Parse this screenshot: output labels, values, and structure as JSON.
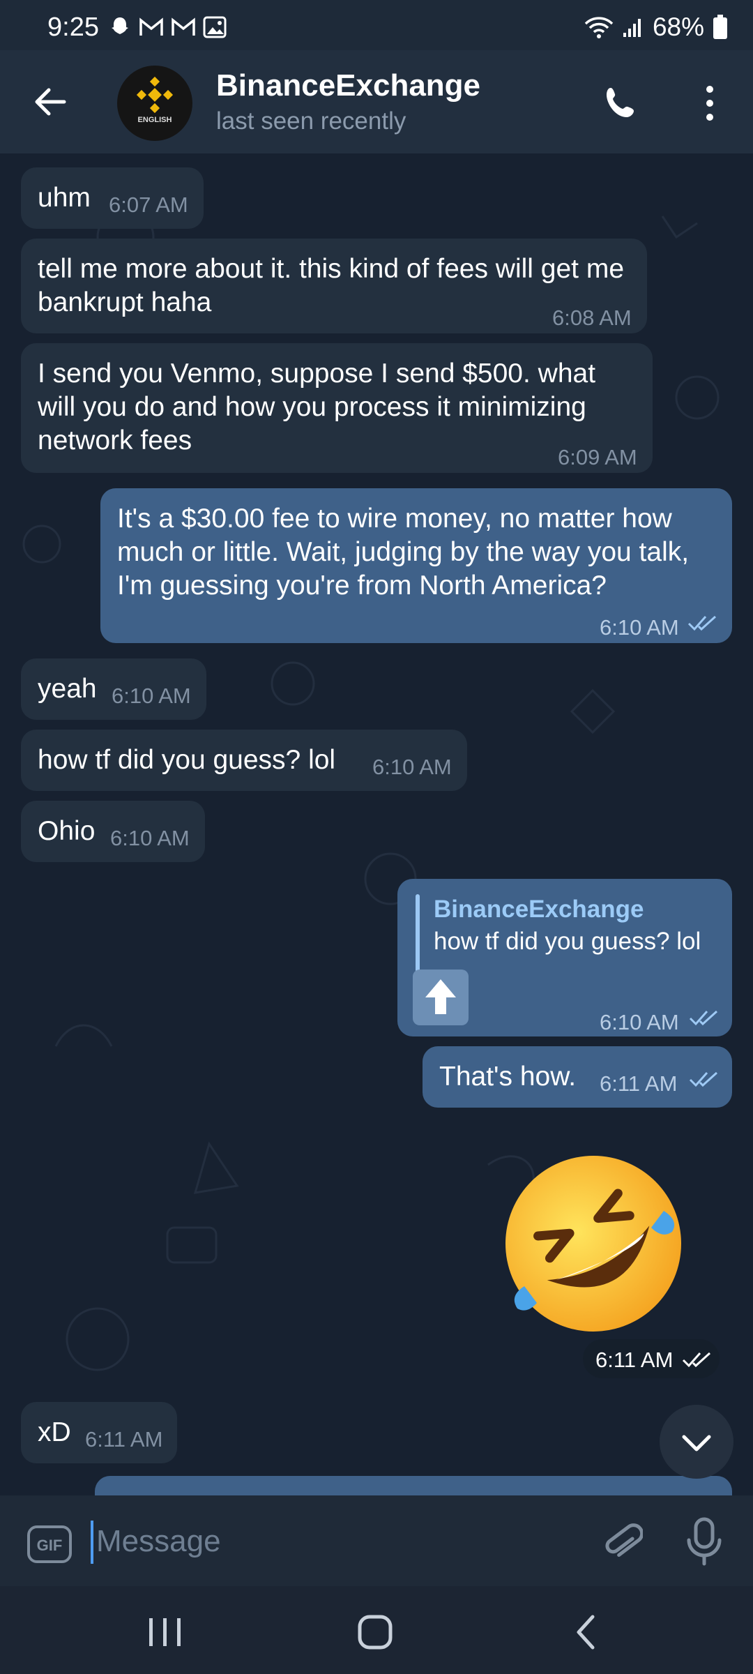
{
  "status": {
    "time": "9:25",
    "battery": "68%"
  },
  "chat": {
    "title": "BinanceExchange",
    "subtitle": "last seen recently",
    "avatar_label": "ENGLISH"
  },
  "messages": [
    {
      "text": "uhm",
      "time": "6:07 AM"
    },
    {
      "text": "tell me more about it. this kind of fees will get me bankrupt haha",
      "time": "6:08 AM"
    },
    {
      "text": "I send you Venmo, suppose I send $500. what will you do and how you process it minimizing network fees",
      "time": "6:09 AM"
    },
    {
      "text": "It's a $30.00 fee to wire money, no matter how much or little. Wait, judging by the way you talk, I'm guessing you're from North America?",
      "time": "6:10 AM"
    },
    {
      "text": "yeah",
      "time": "6:10 AM"
    },
    {
      "text": "how tf did you guess? lol",
      "time": "6:10 AM"
    },
    {
      "text": "Ohio",
      "time": "6:10 AM"
    },
    {
      "reply_name": "BinanceExchange",
      "reply_text": "how tf did you guess? lol",
      "time": "6:10 AM"
    },
    {
      "text": "That's how.",
      "time": "6:11 AM"
    },
    {
      "sticker": "rofl-emoji",
      "time": "6:11 AM"
    },
    {
      "text": "xD",
      "time": "6:11 AM"
    }
  ],
  "input": {
    "placeholder": "Message"
  },
  "icons": [
    "back-arrow-icon",
    "phone-icon",
    "more-vert-icon",
    "gif-icon",
    "attach-icon",
    "mic-icon",
    "chevron-down-icon",
    "double-check-icon"
  ],
  "colors": {
    "incoming": "#23303f",
    "outgoing": "#3f6189",
    "accent": "#4f9cf2"
  }
}
